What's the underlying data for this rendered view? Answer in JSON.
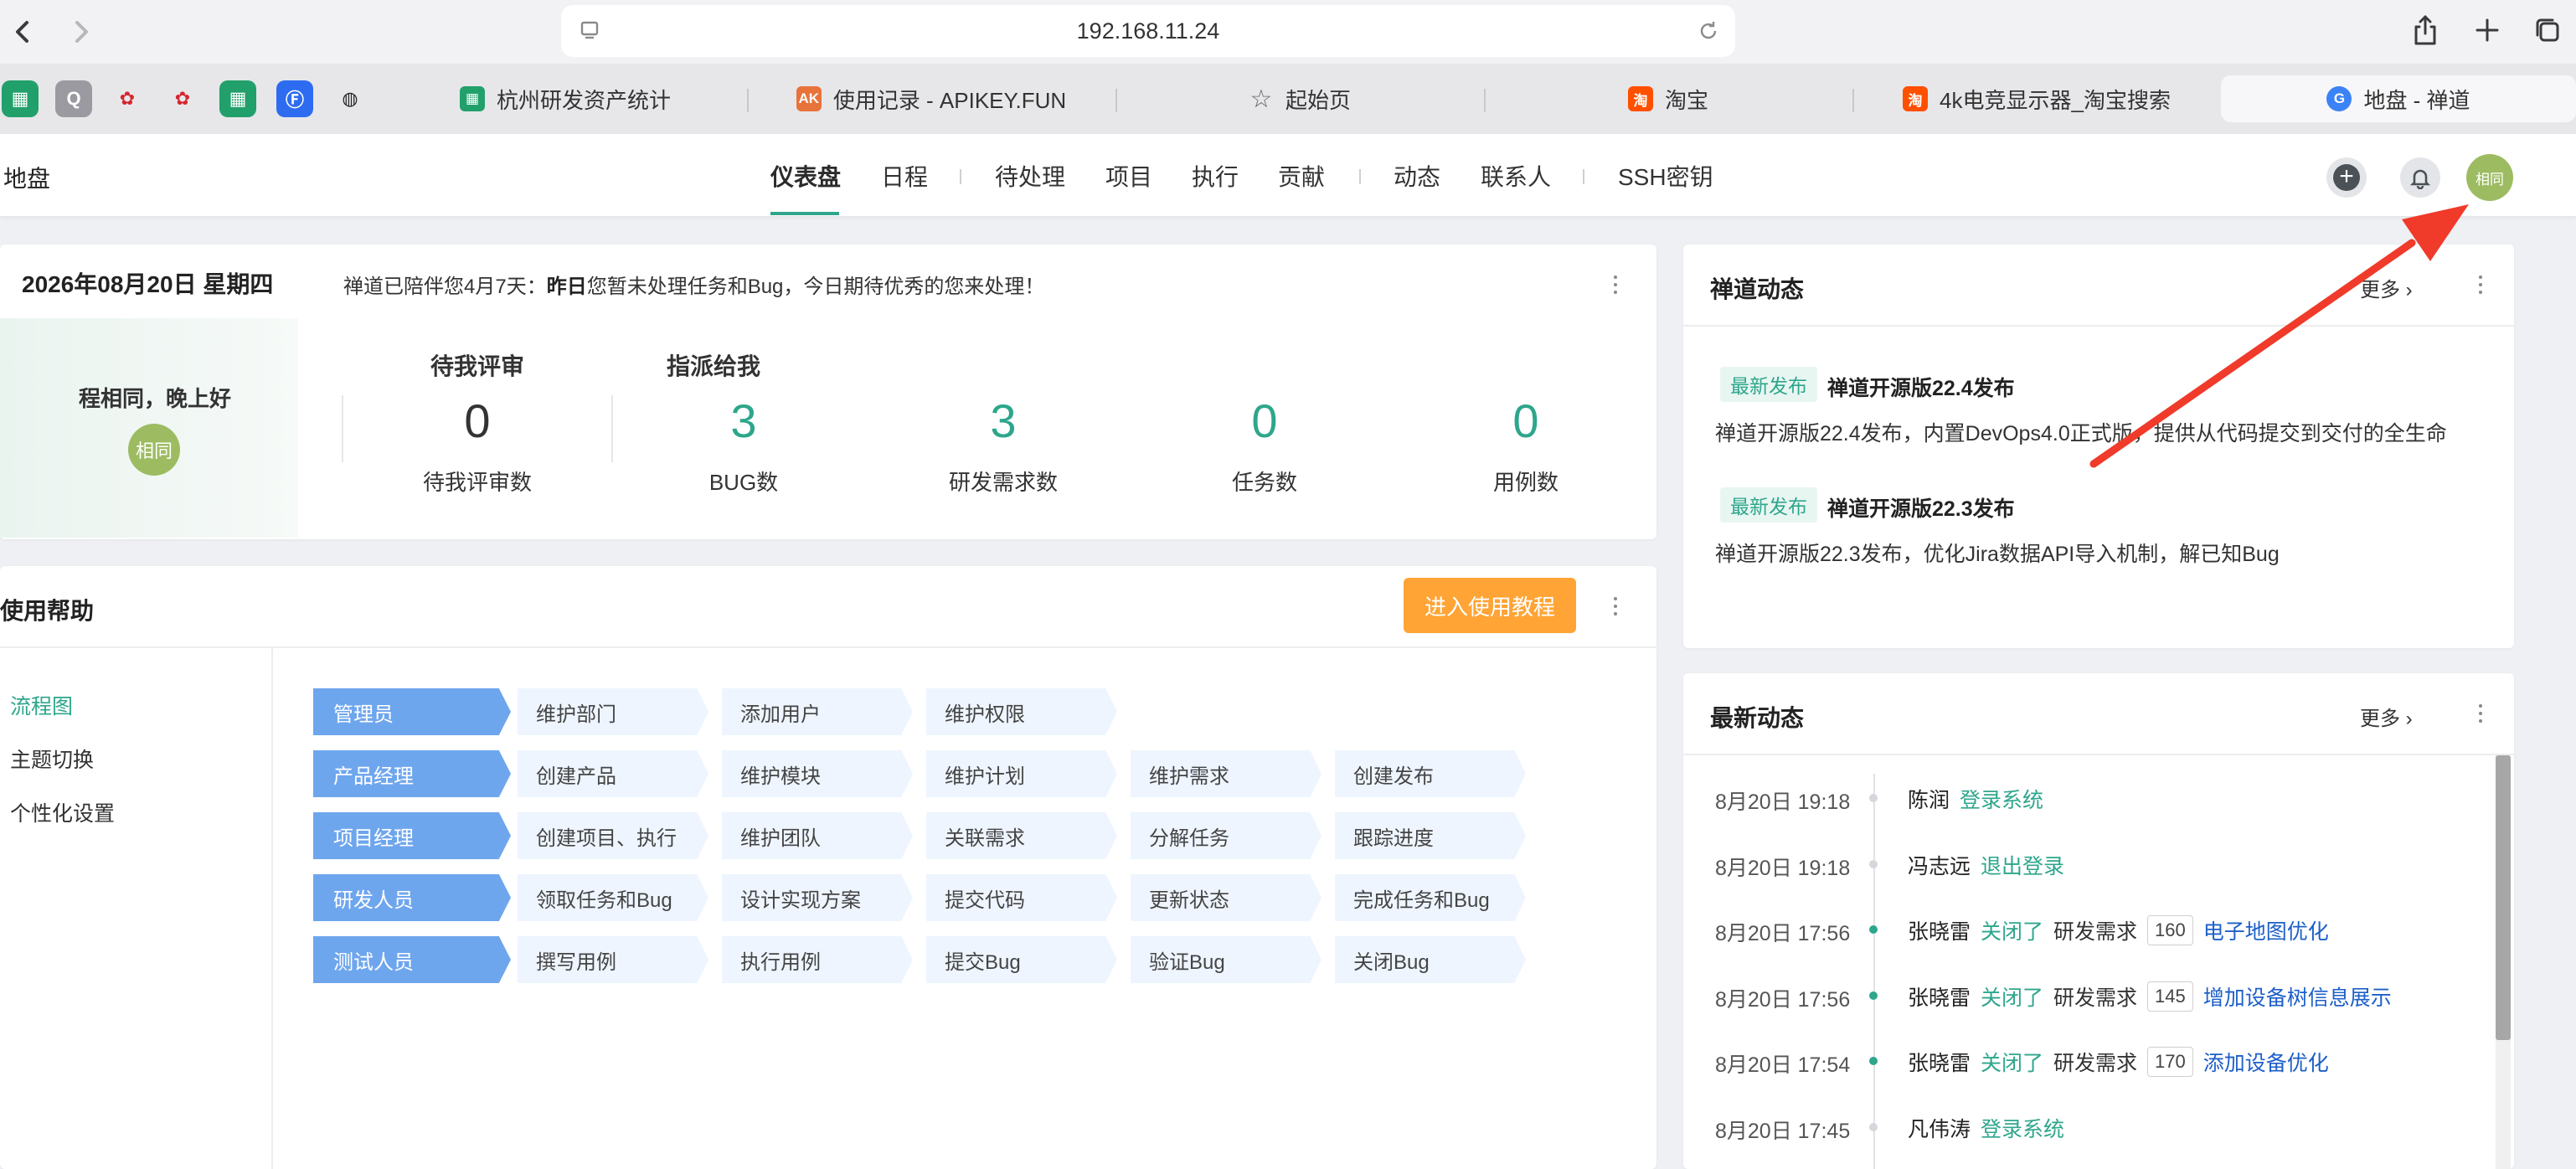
{
  "browser": {
    "url": "192.168.11.24",
    "pinned_tabs": [
      "sheets-icon",
      "q-icon",
      "huawei-icon",
      "huawei-icon",
      "sheets-icon",
      "feishu-icon",
      "shield-icon"
    ],
    "tabs": [
      {
        "label": "杭州研发资产统计",
        "icon": "sheets-icon",
        "icon_color": "#22a06b"
      },
      {
        "label": "使用记录 - APIKEY.FUN",
        "icon": "ak-icon",
        "icon_color": "#e8733a"
      },
      {
        "label": "起始页",
        "icon": "star-icon",
        "icon_color": "#666666"
      },
      {
        "label": "淘宝",
        "icon": "taobao-icon",
        "icon_color": "#ff5000"
      },
      {
        "label": "4k电竞显示器_淘宝搜索",
        "icon": "taobao-icon",
        "icon_color": "#ff5000"
      },
      {
        "label": "地盘 - 禅道",
        "icon": "zentao-icon",
        "icon_color": "#3b82f6"
      }
    ]
  },
  "header": {
    "title": "地盘",
    "menu": [
      "仪表盘",
      "日程",
      "待处理",
      "项目",
      "执行",
      "贡献",
      "动态",
      "联系人",
      "SSH密钥"
    ],
    "avatar_text": "相同"
  },
  "summary": {
    "date": "2026年08月20日 星期四",
    "welcome_prefix": "禅道已陪伴您4月7天：",
    "welcome_bold": "昨日",
    "welcome_rest": "您暂未处理任务和Bug，今日期待优秀的您来处理！",
    "greeting": "程相同，晚上好",
    "avatar_text": "相同",
    "review_head": "待我评审",
    "assign_head": "指派给我",
    "stats": [
      {
        "value": "0",
        "label": "待我评审数",
        "color": "#333333"
      },
      {
        "value": "3",
        "label": "BUG数",
        "color": "#2ea68c"
      },
      {
        "value": "3",
        "label": "研发需求数",
        "color": "#2ea68c"
      },
      {
        "value": "0",
        "label": "任务数",
        "color": "#2ea68c"
      },
      {
        "value": "0",
        "label": "用例数",
        "color": "#2ea68c"
      }
    ]
  },
  "help": {
    "title": "使用帮助",
    "button": "进入使用教程",
    "nav": [
      "流程图",
      "主题切换",
      "个性化设置"
    ],
    "rows": [
      {
        "role": "管理员",
        "steps": [
          "维护部门",
          "添加用户",
          "维护权限"
        ]
      },
      {
        "role": "产品经理",
        "steps": [
          "创建产品",
          "维护模块",
          "维护计划",
          "维护需求",
          "创建发布"
        ]
      },
      {
        "role": "项目经理",
        "steps": [
          "创建项目、执行",
          "维护团队",
          "关联需求",
          "分解任务",
          "跟踪进度"
        ]
      },
      {
        "role": "研发人员",
        "steps": [
          "领取任务和Bug",
          "设计实现方案",
          "提交代码",
          "更新状态",
          "完成任务和Bug"
        ]
      },
      {
        "role": "测试人员",
        "steps": [
          "撰写用例",
          "执行用例",
          "提交Bug",
          "验证Bug",
          "关闭Bug"
        ]
      }
    ]
  },
  "news": {
    "title": "禅道动态",
    "more": "更多",
    "items": [
      {
        "badge": "最新发布",
        "headline": "禅道开源版22.4发布",
        "body": "禅道开源版22.4发布，内置DevOps4.0正式版，提供从代码提交到交付的全生命"
      },
      {
        "badge": "最新发布",
        "headline": "禅道开源版22.3发布",
        "body": "禅道开源版22.3发布，优化Jira数据API导入机制，解已知Bug"
      }
    ]
  },
  "activity": {
    "title": "最新动态",
    "more": "更多",
    "rows": [
      {
        "time": "8月20日 19:18",
        "user": "陈润",
        "action": "登录系统",
        "type": "",
        "id": "",
        "link": "",
        "dot": "gray"
      },
      {
        "time": "8月20日 19:18",
        "user": "冯志远",
        "action": "退出登录",
        "type": "",
        "id": "",
        "link": "",
        "dot": "gray"
      },
      {
        "time": "8月20日 17:56",
        "user": "张晓雷",
        "action": "关闭了",
        "type": "研发需求",
        "id": "160",
        "link": "电子地图优化",
        "dot": "green"
      },
      {
        "time": "8月20日 17:56",
        "user": "张晓雷",
        "action": "关闭了",
        "type": "研发需求",
        "id": "145",
        "link": "增加设备树信息展示",
        "dot": "green"
      },
      {
        "time": "8月20日 17:54",
        "user": "张晓雷",
        "action": "关闭了",
        "type": "研发需求",
        "id": "170",
        "link": "添加设备优化",
        "dot": "green"
      },
      {
        "time": "8月20日 17:45",
        "user": "凡伟涛",
        "action": "登录系统",
        "type": "",
        "id": "",
        "link": "",
        "dot": "gray"
      }
    ]
  },
  "colors": {
    "accent": "#2ea68c",
    "role_blue": "#6ea6ee",
    "orange": "#ffa435",
    "annotation_red": "#f03a2a"
  }
}
